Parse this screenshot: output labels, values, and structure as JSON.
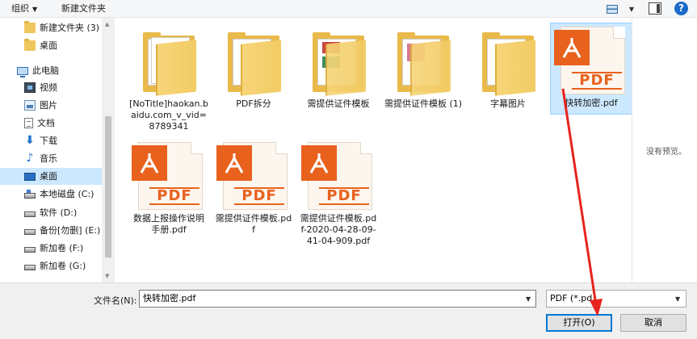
{
  "toolbar": {
    "organize_label": "组织",
    "new_folder_label": "新建文件夹",
    "help_label": "?"
  },
  "sidebar": {
    "items": [
      {
        "label": "新建文件夹 (3)",
        "icon": "folder-icon"
      },
      {
        "label": "桌面",
        "icon": "folder-icon"
      },
      {
        "label": "此电脑",
        "icon": "computer-icon"
      },
      {
        "label": "视频",
        "icon": "video-icon"
      },
      {
        "label": "图片",
        "icon": "pictures-icon"
      },
      {
        "label": "文档",
        "icon": "documents-icon"
      },
      {
        "label": "下载",
        "icon": "download-icon"
      },
      {
        "label": "音乐",
        "icon": "music-icon"
      },
      {
        "label": "桌面",
        "icon": "desktop-icon",
        "selected": true
      },
      {
        "label": "本地磁盘 (C:)",
        "icon": "drive-c-icon"
      },
      {
        "label": "软件 (D:)",
        "icon": "drive-icon"
      },
      {
        "label": "备份[勿删] (E:)",
        "icon": "drive-icon"
      },
      {
        "label": "新加卷 (F:)",
        "icon": "drive-icon"
      },
      {
        "label": "新加卷 (G:)",
        "icon": "drive-icon"
      }
    ]
  },
  "files": [
    {
      "name": "[NoTitle]haokan.baidu.com_v_vid=8789341",
      "type": "folder"
    },
    {
      "name": "PDF拆分",
      "type": "folder"
    },
    {
      "name": "需提供证件模板",
      "type": "folder"
    },
    {
      "name": "需提供证件模板 (1)",
      "type": "folder"
    },
    {
      "name": "字幕图片",
      "type": "folder"
    },
    {
      "name": "快转加密.pdf",
      "type": "pdf",
      "selected": true
    },
    {
      "name": "数据上报操作说明手册.pdf",
      "type": "pdf"
    },
    {
      "name": "需提供证件模板.pdf",
      "type": "pdf"
    },
    {
      "name": "需提供证件模板.pdf-2020-04-28-09-41-04-909.pdf",
      "type": "pdf"
    }
  ],
  "pdf_badge_text": "PDF",
  "preview": {
    "text": "没有预览。"
  },
  "bottom": {
    "filename_label": "文件名(N):",
    "filename_value": "快转加密.pdf",
    "filetype_value": "PDF (*.pd",
    "open_label": "打开(O)",
    "cancel_label": "取消"
  },
  "colors": {
    "selection": "#cce8ff",
    "pdf_orange": "#e8621d",
    "annotation_arrow": "#e8231e"
  }
}
